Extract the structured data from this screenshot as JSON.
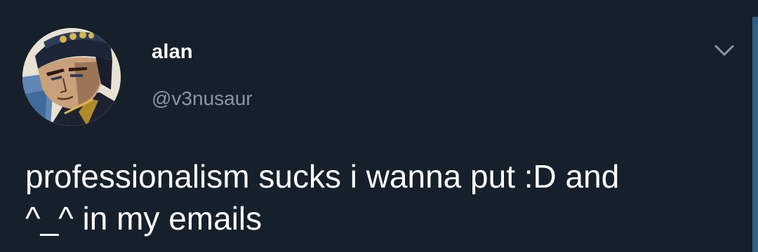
{
  "tweet": {
    "user": {
      "display_name": "alan",
      "handle": "@v3nusaur",
      "avatar": "avatar-illustration"
    },
    "menu_icon": "chevron-down-icon",
    "text": "professionalism sucks i wanna put :D and\n^_^ in my emails"
  },
  "colors": {
    "background": "#16202b",
    "text": "#ffffff",
    "secondary_text": "#8a97a3",
    "accent": "#2c5f8a"
  }
}
